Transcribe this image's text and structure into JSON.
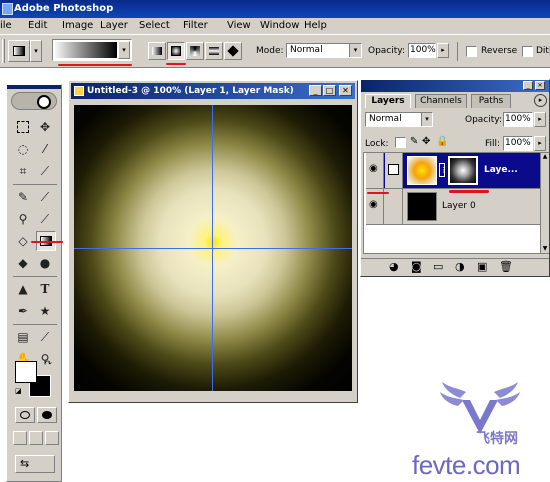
{
  "app": {
    "title": "Adobe Photoshop"
  },
  "menu": {
    "items": [
      "ile",
      "Edit",
      "Image",
      "Layer",
      "Select",
      "Filter",
      "View",
      "Window",
      "Help"
    ]
  },
  "options": {
    "mode_label": "Mode:",
    "mode_value": "Normal",
    "opacity_label": "Opacity:",
    "opacity_value": "100%",
    "reverse_label": "Reverse",
    "dither_label": "Dith"
  },
  "document": {
    "title": "Untitled-3 @ 100% (Layer 1, Layer Mask)"
  },
  "layers_panel": {
    "tabs": [
      "Layers",
      "Channels",
      "Paths"
    ],
    "blend_mode": "Normal",
    "opacity_label": "Opacity:",
    "opacity_value": "100%",
    "lock_label": "Lock:",
    "fill_label": "Fill:",
    "fill_value": "100%",
    "layers": [
      {
        "name": "Laye...",
        "selected": true
      },
      {
        "name": "Layer 0",
        "selected": false
      }
    ]
  },
  "watermark": {
    "brand": "飞特网",
    "domain": "fevte.com"
  },
  "colors": {
    "title_blue": "#0a2a8a",
    "accent_red": "#e0141c",
    "selection_navy": "#0a0a8a"
  }
}
